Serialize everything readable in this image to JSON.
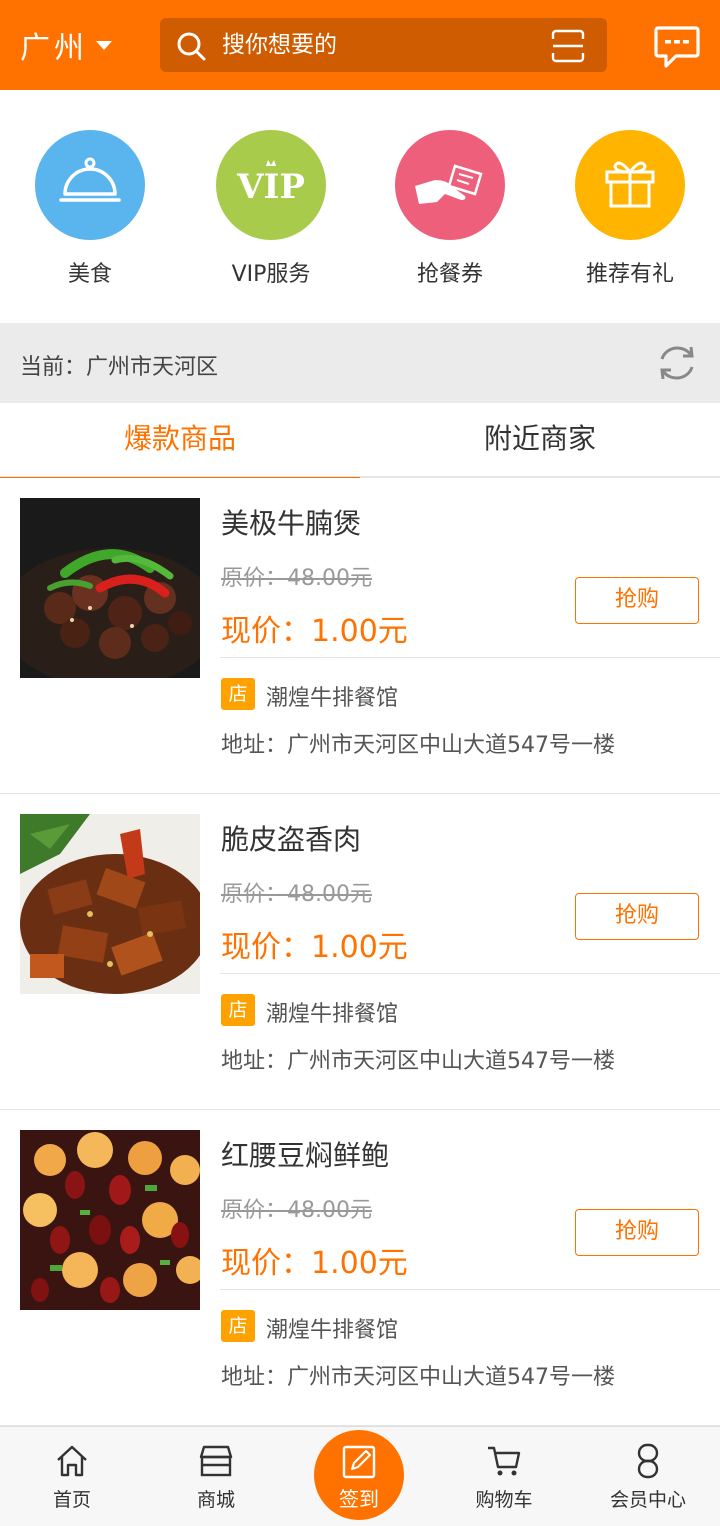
{
  "header": {
    "city": "广州",
    "search_placeholder": "搜你想要的",
    "icons": [
      "dropdown-caret-icon",
      "search-icon",
      "scan-icon",
      "message-icon"
    ]
  },
  "menu": [
    {
      "label": "美食",
      "icon": "food-cloche-icon",
      "color": "#5ab4ee"
    },
    {
      "label": "VIP服务",
      "icon": "vip-icon",
      "color": "#a9cb4c"
    },
    {
      "label": "抢餐券",
      "icon": "coupon-icon",
      "color": "#ee5f7b"
    },
    {
      "label": "推荐有礼",
      "icon": "gift-icon",
      "color": "#ffb400"
    }
  ],
  "location": {
    "text": "当前：广州市天河区",
    "icon": "refresh-icon"
  },
  "tabs": [
    {
      "label": "爆款商品",
      "active": true
    },
    {
      "label": "附近商家",
      "active": false
    }
  ],
  "products": [
    {
      "name": "美极牛腩煲",
      "original_price": "原价：48.00元",
      "current_price": "现价：1.00元",
      "buy_label": "抢购",
      "shop_badge": "店",
      "shop_name": "潮煌牛排餐馆",
      "address": "地址：广州市天河区中山大道547号一楼"
    },
    {
      "name": "脆皮盗香肉",
      "original_price": "原价：48.00元",
      "current_price": "现价：1.00元",
      "buy_label": "抢购",
      "shop_badge": "店",
      "shop_name": "潮煌牛排餐馆",
      "address": "地址：广州市天河区中山大道547号一楼"
    },
    {
      "name": "红腰豆焖鲜鲍",
      "original_price": "原价：48.00元",
      "current_price": "现价：1.00元",
      "buy_label": "抢购",
      "shop_badge": "店",
      "shop_name": "潮煌牛排餐馆",
      "address": "地址：广州市天河区中山大道547号一楼"
    }
  ],
  "bottom_nav": [
    {
      "label": "首页",
      "icon": "home-icon"
    },
    {
      "label": "商城",
      "icon": "store-icon"
    },
    {
      "label": "签到",
      "icon": "edit-icon",
      "highlight": true
    },
    {
      "label": "购物车",
      "icon": "cart-icon"
    },
    {
      "label": "会员中心",
      "icon": "user-icon"
    }
  ],
  "colors": {
    "accent": "#ff7200",
    "search_bg": "#cf5c00",
    "badge": "#ffa200"
  }
}
